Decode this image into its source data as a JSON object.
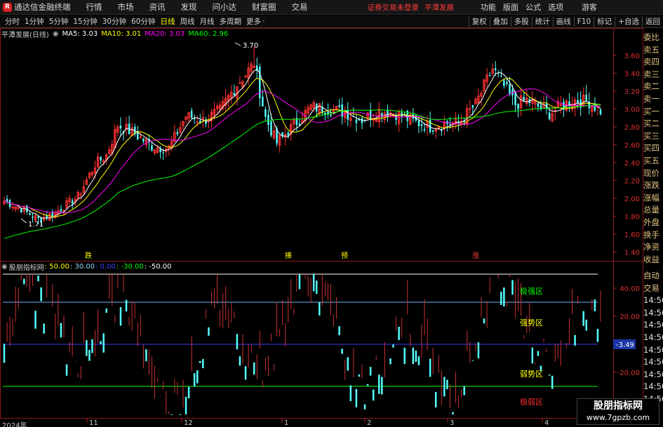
{
  "app": {
    "title": "通达信金融终端",
    "warning": "证券交易未登录",
    "stock_name": "平潭发展",
    "guest": "游客"
  },
  "menu": [
    "行情",
    "市场",
    "资讯",
    "发现",
    "问小达",
    "财富圈",
    "交易"
  ],
  "right_menu": [
    "功能",
    "版面",
    "公式",
    "选项"
  ],
  "periods": [
    "分时",
    "1分钟",
    "5分钟",
    "15分钟",
    "30分钟",
    "60分钟",
    "日线",
    "周线",
    "月线",
    "多周期",
    "更多"
  ],
  "active_period": "日线",
  "tools": [
    "复权",
    "叠加",
    "多股",
    "统计",
    "画线",
    "F10",
    "标记",
    "+自选",
    "返回"
  ],
  "main_legend": {
    "title": "平潭发展(日线)",
    "items": [
      {
        "label": "MA5: 3.03",
        "color": "#ffffff"
      },
      {
        "label": "MA10: 3.01",
        "color": "#ffff00"
      },
      {
        "label": "MA20: 3.03",
        "color": "#ff00ff"
      },
      {
        "label": "MA60: 2.96",
        "color": "#00ff00"
      }
    ]
  },
  "ind_legend": {
    "title": "股朋指标网",
    "items": [
      {
        "label": ": 50.00",
        "color": "#ffff00"
      },
      {
        "label": ": 30.00",
        "color": "#8fd8ff"
      },
      {
        "label": ": 0.00",
        "color": "#4040ff"
      },
      {
        "label": ": -30.00",
        "color": "#00ff00"
      },
      {
        "label": ": -50.00",
        "color": "#ffffff"
      }
    ]
  },
  "right_panel_top": [
    "委比",
    "卖五",
    "卖四",
    "卖三",
    "卖二",
    "卖一",
    "买一",
    "买二",
    "买三",
    "买四",
    "买五",
    "现价",
    "涨跌",
    "涨幅",
    "总量",
    "外盘",
    "换手",
    "净资",
    "收益"
  ],
  "right_panel_bottom": [
    "自动",
    "交易",
    "14:56",
    "14:56",
    "14:56",
    "14:56",
    "14:56",
    "14:56",
    "14:56",
    "14:56",
    "14:56",
    "14:56"
  ],
  "annotations": {
    "high": "3.70",
    "low": "1.71",
    "current_ind": "-3.49"
  },
  "signals": [
    {
      "label": "跌",
      "color": "#ffff00"
    },
    {
      "label": "揍",
      "color": "#ffff00"
    },
    {
      "label": "预",
      "color": "#ffff00"
    },
    {
      "label": "涨",
      "color": "#ff4040"
    }
  ],
  "zones": [
    {
      "label": "极强区",
      "color": "#00ff00"
    },
    {
      "label": "强势区",
      "color": "#ffff00"
    },
    {
      "label": "弱势区",
      "color": "#ffff00"
    },
    {
      "label": "极弱区",
      "color": "#ff3030"
    }
  ],
  "x_labels": [
    "2024年",
    "11",
    "12",
    "1",
    "2",
    "3",
    "4"
  ],
  "watermark": {
    "line1": "股朋指标网",
    "line2": "www.7gpzb.com"
  },
  "chart_data": [
    {
      "type": "candlestick",
      "y_ticks": [
        3.6,
        3.4,
        3.2,
        3.0,
        2.8,
        2.6,
        2.4,
        2.2,
        2.0,
        1.8,
        1.6,
        1.4
      ],
      "ylim": [
        1.3,
        3.78
      ],
      "high": 3.7,
      "low": 1.71,
      "ma": {
        "MA5": 3.03,
        "MA10": 3.01,
        "MA20": 3.03,
        "MA60": 2.96
      },
      "close_anchors": [
        [
          0,
          1.97
        ],
        [
          6,
          1.88
        ],
        [
          12,
          1.76
        ],
        [
          18,
          1.84
        ],
        [
          26,
          2.02
        ],
        [
          32,
          2.38
        ],
        [
          36,
          2.48
        ],
        [
          40,
          2.82
        ],
        [
          46,
          2.72
        ],
        [
          52,
          2.58
        ],
        [
          58,
          2.56
        ],
        [
          64,
          2.92
        ],
        [
          70,
          2.87
        ],
        [
          76,
          2.98
        ],
        [
          82,
          3.28
        ],
        [
          88,
          3.5
        ],
        [
          92,
          2.9
        ],
        [
          96,
          2.62
        ],
        [
          102,
          2.82
        ],
        [
          108,
          3.02
        ],
        [
          114,
          3.0
        ],
        [
          120,
          2.96
        ],
        [
          126,
          2.88
        ],
        [
          132,
          2.98
        ],
        [
          138,
          2.95
        ],
        [
          144,
          2.86
        ],
        [
          150,
          2.8
        ],
        [
          156,
          2.84
        ],
        [
          160,
          2.84
        ],
        [
          166,
          3.05
        ],
        [
          172,
          3.45
        ],
        [
          176,
          3.25
        ],
        [
          180,
          3.05
        ],
        [
          184,
          3.1
        ],
        [
          192,
          2.95
        ],
        [
          200,
          3.1
        ],
        [
          206,
          3.08
        ],
        [
          210,
          2.98
        ]
      ]
    },
    {
      "type": "bar",
      "levels": [
        50,
        30,
        0,
        -30,
        -50
      ],
      "y_ticks": [
        40.0,
        20.0,
        -20.0
      ],
      "current": -3.49
    }
  ]
}
